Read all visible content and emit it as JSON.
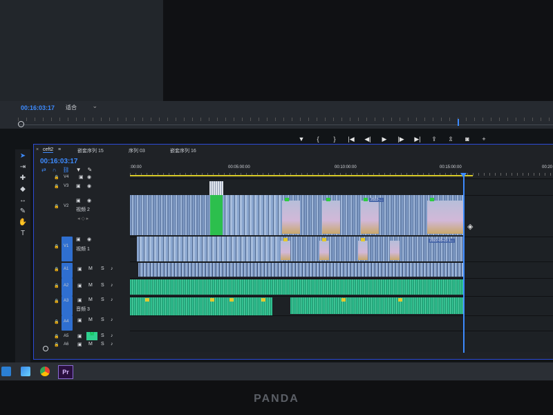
{
  "program_monitor": {
    "timecode": "00:16:03:17",
    "zoom": "适合",
    "controls": [
      "mark-in",
      "mark-out-left",
      "mark-out-right",
      "go-to-in",
      "step-back",
      "play",
      "step-forward",
      "go-to-out",
      "insert",
      "overwrite",
      "export-frame",
      "button-editor"
    ]
  },
  "timeline": {
    "tabs": [
      "ceft2",
      "嵌套序列 15",
      "序列 03",
      "嵌套序列 16"
    ],
    "timecode": "00:16:03:17",
    "ruler_labels": [
      ":00:00",
      "00:05:00:00",
      "00:10:00:00",
      "00:15:00:00",
      "00:20"
    ],
    "tracks": {
      "video": [
        {
          "id": "V4",
          "name": ""
        },
        {
          "id": "V3",
          "name": ""
        },
        {
          "id": "V2",
          "name": "视频 2"
        },
        {
          "id": "V1",
          "name": "视频 1"
        }
      ],
      "audio": [
        {
          "id": "A1",
          "name": ""
        },
        {
          "id": "A2",
          "name": ""
        },
        {
          "id": "A3",
          "name": "音频 3"
        },
        {
          "id": "A4",
          "name": ""
        },
        {
          "id": "A5",
          "name": ""
        },
        {
          "id": "A6",
          "name": ""
        }
      ]
    },
    "track_buttons": {
      "mute": "M",
      "solo": "S"
    },
    "clip_labels": {
      "v2_stamp": "2022-...",
      "v1_stamp": "2022-05-23 1..."
    }
  },
  "tools": [
    "selection-tool",
    "track-select-tool",
    "ripple-edit-tool",
    "razor-tool",
    "slip-tool",
    "pen-tool",
    "hand-tool",
    "type-tool"
  ],
  "taskbar": {
    "premiere_label": "Pr"
  },
  "bezel": {
    "brand": "PANDA"
  },
  "colors": {
    "accent": "#3d8bff",
    "video_clip": "#8aa6cf",
    "audio_clip": "#2fbf8f",
    "work_area": "#d6c826"
  }
}
